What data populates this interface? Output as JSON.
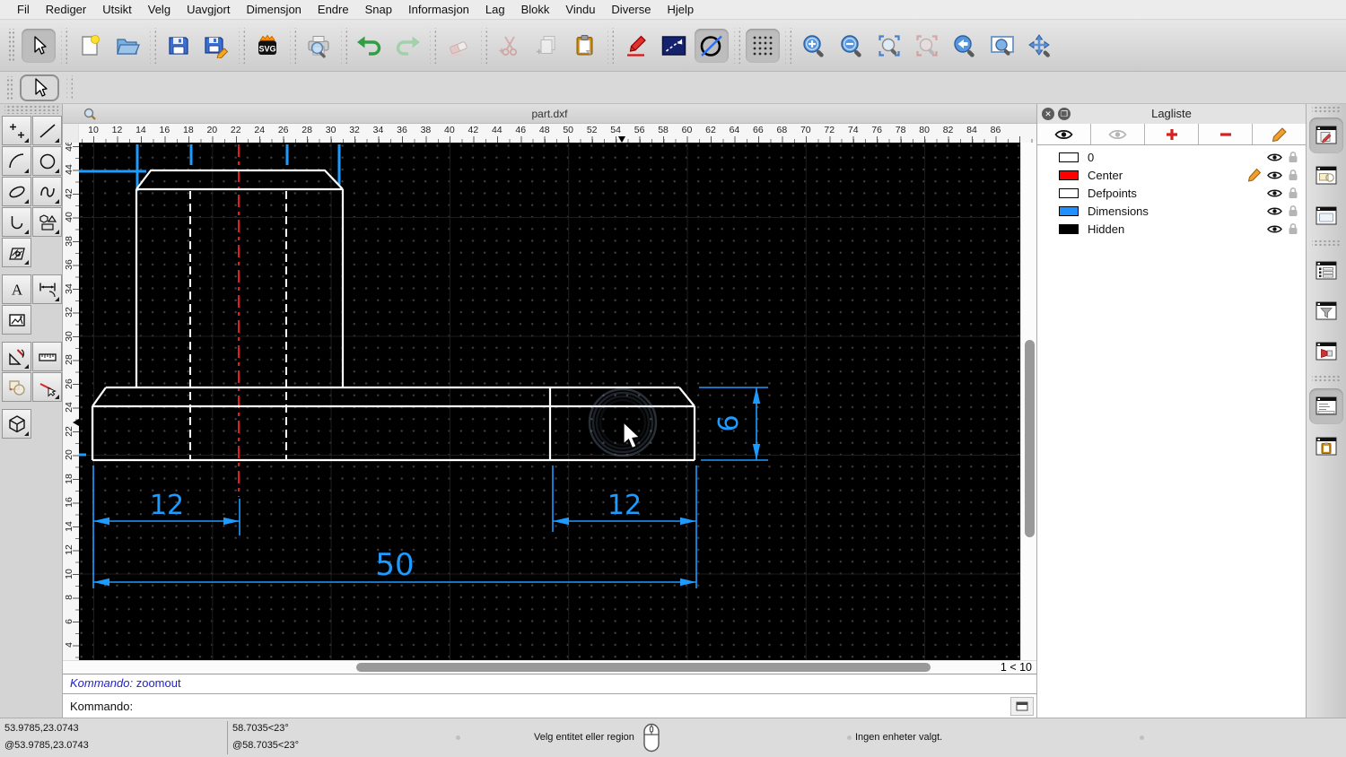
{
  "menu": [
    "Fil",
    "Rediger",
    "Utsikt",
    "Velg",
    "Uavgjort",
    "Dimensjon",
    "Endre",
    "Snap",
    "Informasjon",
    "Lag",
    "Blokk",
    "Vindu",
    "Diverse",
    "Hjelp"
  ],
  "main_toolbar": [
    [
      "select-arrow|active"
    ],
    [
      "new-file",
      "open-file"
    ],
    [
      "save-file",
      "save-file-as"
    ],
    [
      "svg-export"
    ],
    [
      "print-preview"
    ],
    [
      "undo",
      "redo|dim"
    ],
    [
      "eraser|disabled"
    ],
    [
      "cut|disabled",
      "copy|disabled",
      "paste"
    ],
    [
      "draw-pencil",
      "line-rectangle",
      "circle-line|toggled"
    ],
    [
      "grid-toggle|toggled"
    ],
    [
      "zoom-in",
      "zoom-out",
      "zoom-auto",
      "zoom-selection|disabled",
      "zoom-previous",
      "zoom-window",
      "zoom-pan"
    ]
  ],
  "tool_palette": [
    [
      "points",
      "line"
    ],
    [
      "arc",
      "circle"
    ],
    [
      "ellipse",
      "spline"
    ],
    [
      "polyline",
      "shapes"
    ],
    [
      "hatch"
    ],
    "gap",
    [
      "text",
      "dimension"
    ],
    [
      "image"
    ],
    "gap",
    [
      "modify",
      "measure"
    ],
    [
      "select",
      "delete"
    ],
    "gap",
    [
      "solid-3d"
    ]
  ],
  "right_dock": [
    [
      "edit-window|active",
      "blocks-window",
      "library-window"
    ],
    [
      "list-window",
      "filter-window",
      "plugin-window"
    ],
    [
      "command-window|active",
      "clipboard-window"
    ]
  ],
  "document": {
    "title": "part.dxf",
    "zoom_ratio": "1 < 10"
  },
  "rulers": {
    "horizontal": [
      10,
      12,
      14,
      16,
      18,
      20,
      22,
      24,
      26,
      28,
      30,
      32,
      34,
      36,
      38,
      40,
      42,
      44,
      46,
      48,
      50,
      52,
      54,
      56,
      58,
      60,
      62,
      64,
      66,
      68,
      70,
      72,
      74,
      76,
      78,
      80,
      82,
      84,
      86
    ],
    "vertical": [
      46,
      44,
      42,
      40,
      38,
      36,
      34,
      32,
      30,
      28,
      26,
      24,
      22,
      20,
      18,
      16,
      14,
      12,
      10,
      8,
      6,
      4
    ]
  },
  "drawing": {
    "dim_left": "12",
    "dim_right": "12",
    "dim_total": "50",
    "dim_height": "6"
  },
  "command_panel": {
    "history_prompt": "Kommando:",
    "history_command": "zoomout",
    "input_prompt": "Kommando:"
  },
  "layer_panel": {
    "title": "Lagliste",
    "toolbar": [
      "layer-visibility",
      "layer-visibility-dim",
      "layer-add",
      "layer-remove",
      "layer-edit"
    ],
    "layers": [
      {
        "name": "0",
        "color": "#ffffff",
        "editing": false
      },
      {
        "name": "Center",
        "color": "#ff0000",
        "editing": true
      },
      {
        "name": "Defpoints",
        "color": "#ffffff",
        "editing": false
      },
      {
        "name": "Dimensions",
        "color": "#1e90ff",
        "editing": false
      },
      {
        "name": "Hidden",
        "color": "#000000",
        "editing": false
      }
    ]
  },
  "status_bar": {
    "abs_coord": "53.9785,23.0743",
    "rel_coord": "@53.9785,23.0743",
    "abs_polar": "58.7035<23°",
    "rel_polar": "@58.7035<23°",
    "hint": "Velg entitet eller region",
    "selection": "Ingen enheter valgt."
  },
  "colors": {
    "dimension_blue": "#1e9bff",
    "centerline_red": "#ff2020",
    "entity_white": "#ffffff",
    "canvas_black": "#000000"
  }
}
